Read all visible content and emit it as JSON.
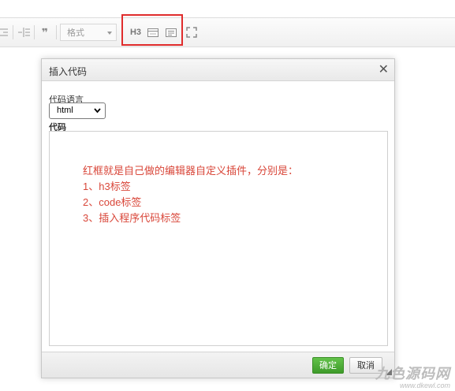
{
  "toolbar": {
    "format_placeholder": "格式",
    "quote_glyph": "❞",
    "h3_label": "H3"
  },
  "dialog": {
    "title": "插入代码",
    "close_glyph": "✕",
    "language_label": "代码语言",
    "language_value": "html",
    "code_label": "代码",
    "code_lines": [
      "红框就是自己做的编辑器自定义插件，分别是：",
      "1、h3标签",
      "2、code标签",
      "3、插入程序代码标签"
    ],
    "ok_label": "确定",
    "cancel_label": "取消"
  },
  "watermark": {
    "name": "九色源码网",
    "url": "www.dkewl.com"
  },
  "colors": {
    "highlight_border": "#e02c2c",
    "code_text": "#d9473a",
    "ok_button": "#4caf36"
  }
}
